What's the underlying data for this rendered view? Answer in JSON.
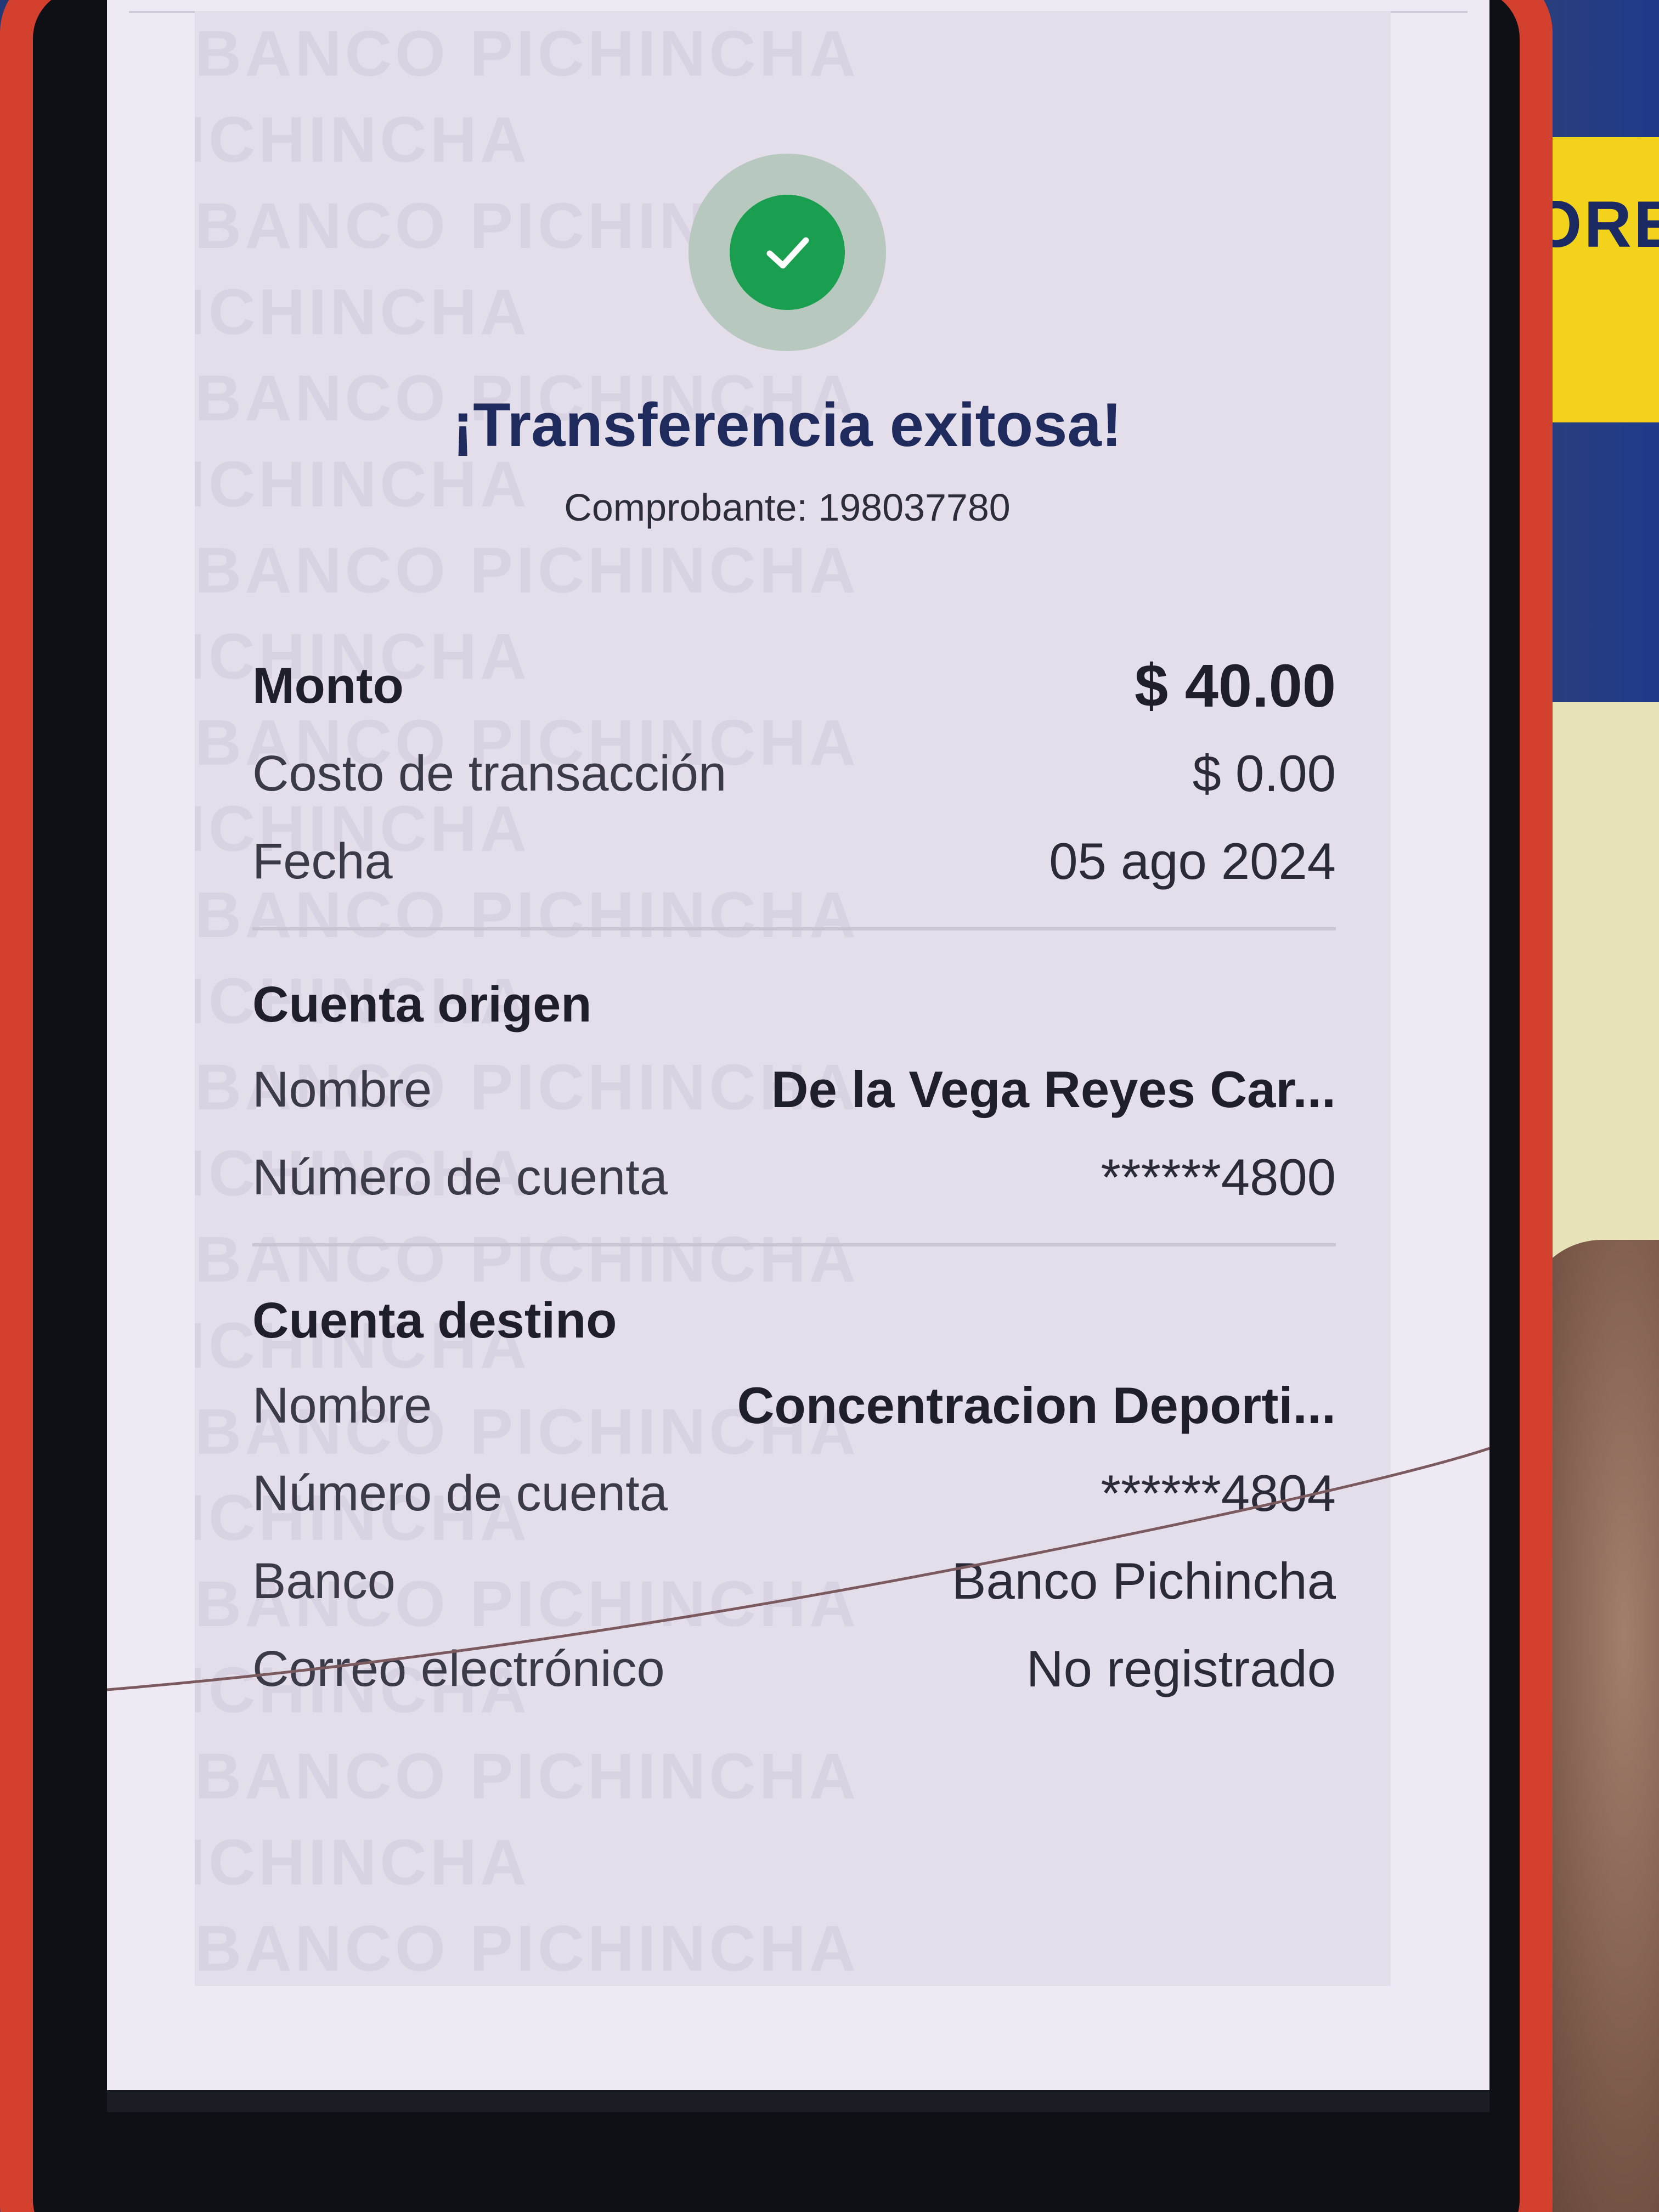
{
  "background": {
    "sign_text": "ORE"
  },
  "watermark": {
    "text": "BANCO PICHINCHA"
  },
  "status": {
    "icon": "check-icon",
    "color": "#1a9e4f"
  },
  "header": {
    "title": "¡Transferencia exitosa!",
    "receipt": "Comprobante: 198037780"
  },
  "summary": [
    {
      "label": "Monto",
      "value": "$ 40.00"
    },
    {
      "label": "Costo de transacción",
      "value": "$ 0.00"
    },
    {
      "label": "Fecha",
      "value": "05 ago 2024"
    }
  ],
  "origin": {
    "title": "Cuenta origen",
    "rows": [
      {
        "label": "Nombre",
        "value": "De la Vega Reyes Car..."
      },
      {
        "label": "Número de cuenta",
        "value": "******4800"
      }
    ]
  },
  "destination": {
    "title": "Cuenta destino",
    "rows": [
      {
        "label": "Nombre",
        "value": "Concentracion Deporti..."
      },
      {
        "label": "Número de cuenta",
        "value": "******4804"
      },
      {
        "label": "Banco",
        "value": "Banco Pichincha"
      },
      {
        "label": "Correo electrónico",
        "value": "No registrado"
      }
    ]
  }
}
